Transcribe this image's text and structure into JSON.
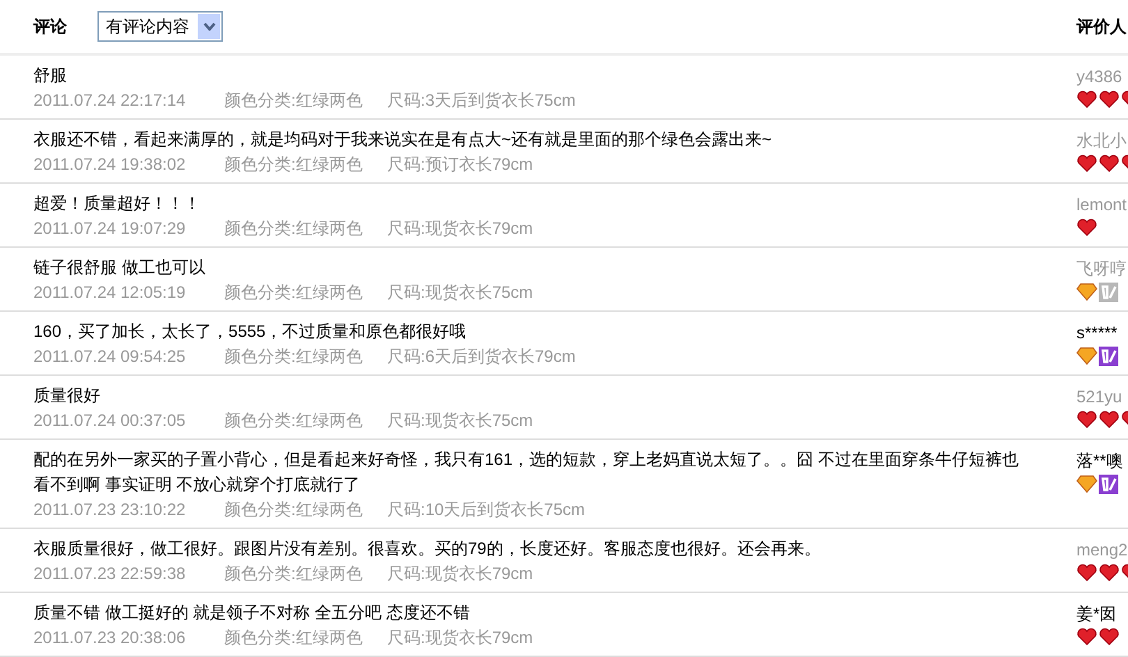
{
  "header": {
    "comment_label": "评论",
    "filter": {
      "value": "有评论内容"
    },
    "reviewer_label": "评价人"
  },
  "reviews": [
    {
      "text": "舒服",
      "date": "2011.07.24 22:17:14",
      "variant": "颜色分类:红绿两色",
      "size": "尺码:3天后到货衣长75cm",
      "reviewer": "y4386",
      "anonymous": false,
      "badges": [
        {
          "kind": "heart"
        },
        {
          "kind": "heart"
        },
        {
          "kind": "heart"
        }
      ]
    },
    {
      "text": "衣服还不错，看起来满厚的，就是均码对于我来说实在是有点大~还有就是里面的那个绿色会露出来~",
      "date": "2011.07.24 19:38:02",
      "variant": "颜色分类:红绿两色",
      "size": "尺码:预订衣长79cm",
      "reviewer": "水北小",
      "anonymous": false,
      "badges": [
        {
          "kind": "heart"
        },
        {
          "kind": "heart"
        },
        {
          "kind": "heart"
        }
      ]
    },
    {
      "text": "超爱！质量超好！！！",
      "date": "2011.07.24 19:07:29",
      "variant": "颜色分类:红绿两色",
      "size": "尺码:现货衣长79cm",
      "reviewer": "lemont",
      "anonymous": false,
      "badges": [
        {
          "kind": "heart"
        }
      ]
    },
    {
      "text": "链子很舒服 做工也可以",
      "date": "2011.07.24 12:05:19",
      "variant": "颜色分类:红绿两色",
      "size": "尺码:现货衣长75cm",
      "reviewer": "飞呀哼",
      "anonymous": false,
      "badges": [
        {
          "kind": "diamond"
        },
        {
          "kind": "vip_inactive"
        }
      ]
    },
    {
      "text": "160，买了加长，太长了，5555，不过质量和原色都很好哦",
      "date": "2011.07.24 09:54:25",
      "variant": "颜色分类:红绿两色",
      "size": "尺码:6天后到货衣长79cm",
      "reviewer": "s*****",
      "anonymous": true,
      "badges": [
        {
          "kind": "diamond"
        },
        {
          "kind": "vip"
        }
      ]
    },
    {
      "text": "质量很好",
      "date": "2011.07.24 00:37:05",
      "variant": "颜色分类:红绿两色",
      "size": "尺码:现货衣长75cm",
      "reviewer": "521yu",
      "anonymous": false,
      "badges": [
        {
          "kind": "heart"
        },
        {
          "kind": "heart"
        },
        {
          "kind": "heart"
        }
      ]
    },
    {
      "text": "配的在另外一家买的子置小背心，但是看起来好奇怪，我只有161，选的短款，穿上老妈直说太短了。。囧 不过在里面穿条牛仔短裤也看不到啊 事实证明 不放心就穿个打底就行了",
      "date": "2011.07.23 23:10:22",
      "variant": "颜色分类:红绿两色",
      "size": "尺码:10天后到货衣长75cm",
      "reviewer": "落**噢",
      "anonymous": true,
      "badges": [
        {
          "kind": "diamond"
        },
        {
          "kind": "vip"
        }
      ]
    },
    {
      "text": "衣服质量很好，做工很好。跟图片没有差别。很喜欢。买的79的，长度还好。客服态度也很好。还会再来。",
      "date": "2011.07.23 22:59:38",
      "variant": "颜色分类:红绿两色",
      "size": "尺码:现货衣长79cm",
      "reviewer": "meng2",
      "anonymous": false,
      "badges": [
        {
          "kind": "heart"
        },
        {
          "kind": "heart"
        },
        {
          "kind": "heart"
        }
      ]
    },
    {
      "text": "质量不错 做工挺好的 就是领子不对称 全五分吧 态度还不错",
      "date": "2011.07.23 20:38:06",
      "variant": "颜色分类:红绿两色",
      "size": "尺码:现货衣长79cm",
      "reviewer": "姜*囡",
      "anonymous": true,
      "badges": [
        {
          "kind": "heart"
        },
        {
          "kind": "heart"
        }
      ]
    }
  ]
}
